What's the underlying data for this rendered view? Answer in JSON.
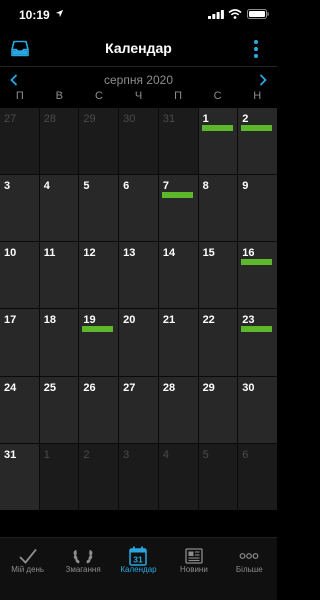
{
  "status": {
    "time": "10:19"
  },
  "header": {
    "title": "Календар"
  },
  "month": {
    "label": "серпня 2020"
  },
  "weekdays": [
    "П",
    "В",
    "С",
    "Ч",
    "П",
    "С",
    "Н"
  ],
  "days": [
    {
      "n": "27",
      "current": false,
      "event": false
    },
    {
      "n": "28",
      "current": false,
      "event": false
    },
    {
      "n": "29",
      "current": false,
      "event": false
    },
    {
      "n": "30",
      "current": false,
      "event": false
    },
    {
      "n": "31",
      "current": false,
      "event": false
    },
    {
      "n": "1",
      "current": true,
      "event": true
    },
    {
      "n": "2",
      "current": true,
      "event": true
    },
    {
      "n": "3",
      "current": true,
      "event": false
    },
    {
      "n": "4",
      "current": true,
      "event": false
    },
    {
      "n": "5",
      "current": true,
      "event": false
    },
    {
      "n": "6",
      "current": true,
      "event": false
    },
    {
      "n": "7",
      "current": true,
      "event": true
    },
    {
      "n": "8",
      "current": true,
      "event": false
    },
    {
      "n": "9",
      "current": true,
      "event": false
    },
    {
      "n": "10",
      "current": true,
      "event": false
    },
    {
      "n": "11",
      "current": true,
      "event": false
    },
    {
      "n": "12",
      "current": true,
      "event": false
    },
    {
      "n": "13",
      "current": true,
      "event": false
    },
    {
      "n": "14",
      "current": true,
      "event": false
    },
    {
      "n": "15",
      "current": true,
      "event": false
    },
    {
      "n": "16",
      "current": true,
      "event": true
    },
    {
      "n": "17",
      "current": true,
      "event": false
    },
    {
      "n": "18",
      "current": true,
      "event": false
    },
    {
      "n": "19",
      "current": true,
      "event": true
    },
    {
      "n": "20",
      "current": true,
      "event": false
    },
    {
      "n": "21",
      "current": true,
      "event": false
    },
    {
      "n": "22",
      "current": true,
      "event": false
    },
    {
      "n": "23",
      "current": true,
      "event": true
    },
    {
      "n": "24",
      "current": true,
      "event": false
    },
    {
      "n": "25",
      "current": true,
      "event": false
    },
    {
      "n": "26",
      "current": true,
      "event": false
    },
    {
      "n": "27",
      "current": true,
      "event": false
    },
    {
      "n": "28",
      "current": true,
      "event": false
    },
    {
      "n": "29",
      "current": true,
      "event": false
    },
    {
      "n": "30",
      "current": true,
      "event": false
    },
    {
      "n": "31",
      "current": true,
      "event": false
    },
    {
      "n": "1",
      "current": false,
      "event": false
    },
    {
      "n": "2",
      "current": false,
      "event": false
    },
    {
      "n": "3",
      "current": false,
      "event": false
    },
    {
      "n": "4",
      "current": false,
      "event": false
    },
    {
      "n": "5",
      "current": false,
      "event": false
    },
    {
      "n": "6",
      "current": false,
      "event": false
    }
  ],
  "tabs": [
    {
      "label": "Мій день",
      "icon": "checkmark-icon",
      "active": false
    },
    {
      "label": "Змагання",
      "icon": "laurel-icon",
      "active": false
    },
    {
      "label": "Календар",
      "icon": "calendar-icon",
      "active": true,
      "icon_text": "31"
    },
    {
      "label": "Новини",
      "icon": "newspaper-icon",
      "active": false
    },
    {
      "label": "Більше",
      "icon": "more-dots-icon",
      "active": false
    }
  ],
  "colors": {
    "accent": "#2aa6e0",
    "event": "#5cb82a",
    "background": "#000000",
    "cell": "#282828",
    "cell_other_month": "#1b1b1b"
  }
}
